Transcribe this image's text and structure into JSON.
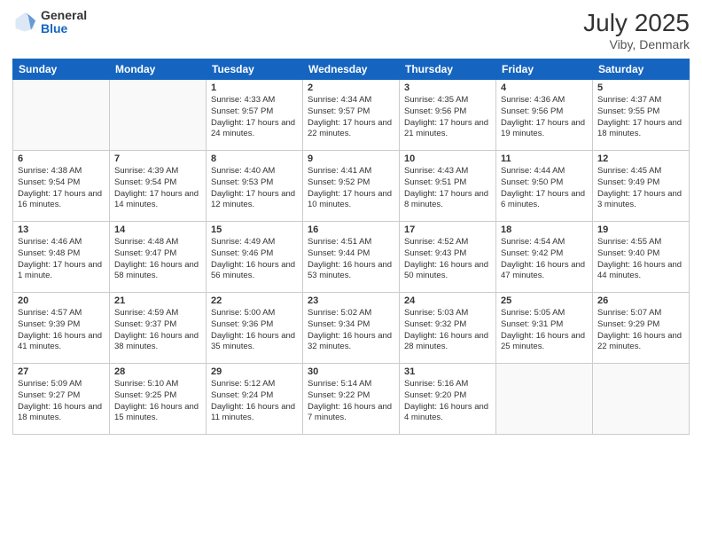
{
  "header": {
    "logo_general": "General",
    "logo_blue": "Blue",
    "month_year": "July 2025",
    "location": "Viby, Denmark"
  },
  "weekdays": [
    "Sunday",
    "Monday",
    "Tuesday",
    "Wednesday",
    "Thursday",
    "Friday",
    "Saturday"
  ],
  "weeks": [
    [
      {
        "day": "",
        "info": ""
      },
      {
        "day": "",
        "info": ""
      },
      {
        "day": "1",
        "info": "Sunrise: 4:33 AM\nSunset: 9:57 PM\nDaylight: 17 hours and 24 minutes."
      },
      {
        "day": "2",
        "info": "Sunrise: 4:34 AM\nSunset: 9:57 PM\nDaylight: 17 hours and 22 minutes."
      },
      {
        "day": "3",
        "info": "Sunrise: 4:35 AM\nSunset: 9:56 PM\nDaylight: 17 hours and 21 minutes."
      },
      {
        "day": "4",
        "info": "Sunrise: 4:36 AM\nSunset: 9:56 PM\nDaylight: 17 hours and 19 minutes."
      },
      {
        "day": "5",
        "info": "Sunrise: 4:37 AM\nSunset: 9:55 PM\nDaylight: 17 hours and 18 minutes."
      }
    ],
    [
      {
        "day": "6",
        "info": "Sunrise: 4:38 AM\nSunset: 9:54 PM\nDaylight: 17 hours and 16 minutes."
      },
      {
        "day": "7",
        "info": "Sunrise: 4:39 AM\nSunset: 9:54 PM\nDaylight: 17 hours and 14 minutes."
      },
      {
        "day": "8",
        "info": "Sunrise: 4:40 AM\nSunset: 9:53 PM\nDaylight: 17 hours and 12 minutes."
      },
      {
        "day": "9",
        "info": "Sunrise: 4:41 AM\nSunset: 9:52 PM\nDaylight: 17 hours and 10 minutes."
      },
      {
        "day": "10",
        "info": "Sunrise: 4:43 AM\nSunset: 9:51 PM\nDaylight: 17 hours and 8 minutes."
      },
      {
        "day": "11",
        "info": "Sunrise: 4:44 AM\nSunset: 9:50 PM\nDaylight: 17 hours and 6 minutes."
      },
      {
        "day": "12",
        "info": "Sunrise: 4:45 AM\nSunset: 9:49 PM\nDaylight: 17 hours and 3 minutes."
      }
    ],
    [
      {
        "day": "13",
        "info": "Sunrise: 4:46 AM\nSunset: 9:48 PM\nDaylight: 17 hours and 1 minute."
      },
      {
        "day": "14",
        "info": "Sunrise: 4:48 AM\nSunset: 9:47 PM\nDaylight: 16 hours and 58 minutes."
      },
      {
        "day": "15",
        "info": "Sunrise: 4:49 AM\nSunset: 9:46 PM\nDaylight: 16 hours and 56 minutes."
      },
      {
        "day": "16",
        "info": "Sunrise: 4:51 AM\nSunset: 9:44 PM\nDaylight: 16 hours and 53 minutes."
      },
      {
        "day": "17",
        "info": "Sunrise: 4:52 AM\nSunset: 9:43 PM\nDaylight: 16 hours and 50 minutes."
      },
      {
        "day": "18",
        "info": "Sunrise: 4:54 AM\nSunset: 9:42 PM\nDaylight: 16 hours and 47 minutes."
      },
      {
        "day": "19",
        "info": "Sunrise: 4:55 AM\nSunset: 9:40 PM\nDaylight: 16 hours and 44 minutes."
      }
    ],
    [
      {
        "day": "20",
        "info": "Sunrise: 4:57 AM\nSunset: 9:39 PM\nDaylight: 16 hours and 41 minutes."
      },
      {
        "day": "21",
        "info": "Sunrise: 4:59 AM\nSunset: 9:37 PM\nDaylight: 16 hours and 38 minutes."
      },
      {
        "day": "22",
        "info": "Sunrise: 5:00 AM\nSunset: 9:36 PM\nDaylight: 16 hours and 35 minutes."
      },
      {
        "day": "23",
        "info": "Sunrise: 5:02 AM\nSunset: 9:34 PM\nDaylight: 16 hours and 32 minutes."
      },
      {
        "day": "24",
        "info": "Sunrise: 5:03 AM\nSunset: 9:32 PM\nDaylight: 16 hours and 28 minutes."
      },
      {
        "day": "25",
        "info": "Sunrise: 5:05 AM\nSunset: 9:31 PM\nDaylight: 16 hours and 25 minutes."
      },
      {
        "day": "26",
        "info": "Sunrise: 5:07 AM\nSunset: 9:29 PM\nDaylight: 16 hours and 22 minutes."
      }
    ],
    [
      {
        "day": "27",
        "info": "Sunrise: 5:09 AM\nSunset: 9:27 PM\nDaylight: 16 hours and 18 minutes."
      },
      {
        "day": "28",
        "info": "Sunrise: 5:10 AM\nSunset: 9:25 PM\nDaylight: 16 hours and 15 minutes."
      },
      {
        "day": "29",
        "info": "Sunrise: 5:12 AM\nSunset: 9:24 PM\nDaylight: 16 hours and 11 minutes."
      },
      {
        "day": "30",
        "info": "Sunrise: 5:14 AM\nSunset: 9:22 PM\nDaylight: 16 hours and 7 minutes."
      },
      {
        "day": "31",
        "info": "Sunrise: 5:16 AM\nSunset: 9:20 PM\nDaylight: 16 hours and 4 minutes."
      },
      {
        "day": "",
        "info": ""
      },
      {
        "day": "",
        "info": ""
      }
    ]
  ]
}
